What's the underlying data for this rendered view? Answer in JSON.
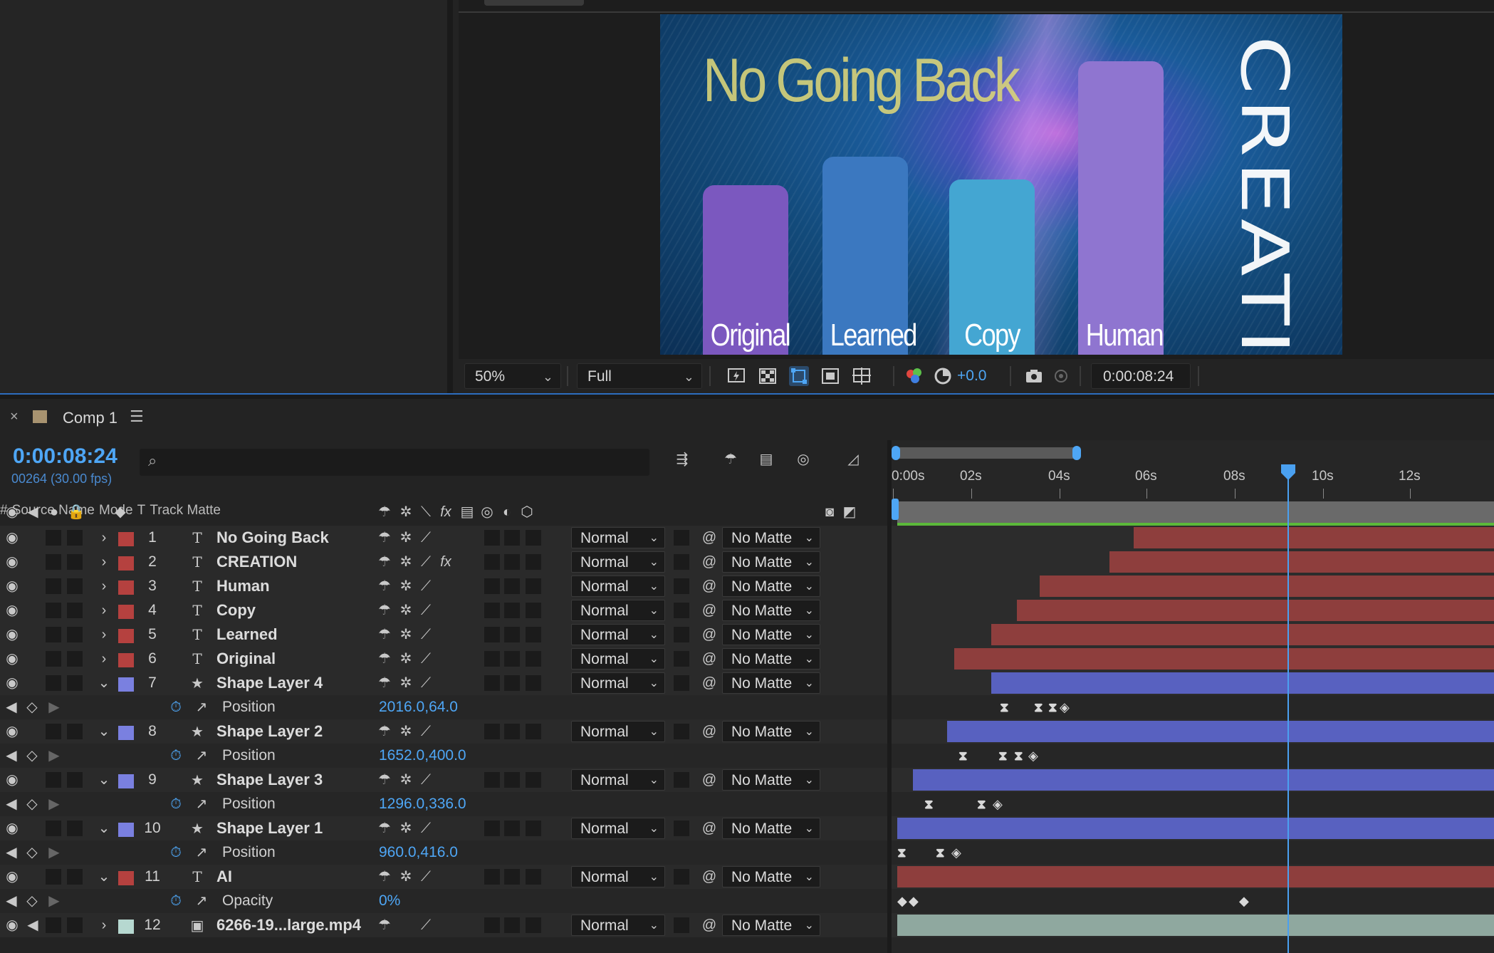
{
  "viewer": {
    "comp_title_text": "No Going Back",
    "comp_vertical_text": "CREATION",
    "bars": [
      {
        "label": "Original",
        "color": "#7b58bf"
      },
      {
        "label": "Learned",
        "color": "#3b78c0"
      },
      {
        "label": "Copy",
        "color": "#44a6d2"
      },
      {
        "label": "Human",
        "color": "#8f75d0"
      }
    ],
    "zoom": "50%",
    "resolution": "Full",
    "exposure": "+0.0",
    "timecode": "0:00:08:24",
    "icons": [
      "fast-previews-icon",
      "transparency-grid-icon",
      "mask-path-icon",
      "region-of-interest-icon",
      "safe-margins-icon",
      "channel-icon",
      "reset-exposure-icon",
      "snapshot-icon",
      "show-snapshot-icon"
    ]
  },
  "timeline": {
    "tab_label": "Comp 1",
    "current_time": "0:00:08:24",
    "frame_info": "00264 (30.00 fps)",
    "search_placeholder": "",
    "columns": {
      "number": "#",
      "source_name": "Source Name",
      "mode": "Mode",
      "t": "T",
      "track_matte": "Track Matte"
    },
    "ruler": [
      "0:00s",
      "02s",
      "04s",
      "06s",
      "08s",
      "10s",
      "12s"
    ],
    "layers": [
      {
        "num": "1",
        "type": "T",
        "name": "No Going Back",
        "color": "#b5413f",
        "mode": "Normal",
        "matte": "No Matte",
        "fx": false
      },
      {
        "num": "2",
        "type": "T",
        "name": "CREATION",
        "color": "#b5413f",
        "mode": "Normal",
        "matte": "No Matte",
        "fx": true
      },
      {
        "num": "3",
        "type": "T",
        "name": "Human",
        "color": "#b5413f",
        "mode": "Normal",
        "matte": "No Matte",
        "fx": false
      },
      {
        "num": "4",
        "type": "T",
        "name": "Copy",
        "color": "#b5413f",
        "mode": "Normal",
        "matte": "No Matte",
        "fx": false
      },
      {
        "num": "5",
        "type": "T",
        "name": "Learned",
        "color": "#b5413f",
        "mode": "Normal",
        "matte": "No Matte",
        "fx": false
      },
      {
        "num": "6",
        "type": "T",
        "name": "Original",
        "color": "#b5413f",
        "mode": "Normal",
        "matte": "No Matte",
        "fx": false
      },
      {
        "num": "7",
        "type": "★",
        "name": "Shape Layer 4",
        "color": "#7a80e0",
        "mode": "Normal",
        "matte": "No Matte",
        "fx": false,
        "prop": {
          "name": "Position",
          "value": "2016.0,64.0"
        }
      },
      {
        "num": "8",
        "type": "★",
        "name": "Shape Layer 2",
        "color": "#7a80e0",
        "mode": "Normal",
        "matte": "No Matte",
        "fx": false,
        "prop": {
          "name": "Position",
          "value": "1652.0,400.0"
        }
      },
      {
        "num": "9",
        "type": "★",
        "name": "Shape Layer 3",
        "color": "#7a80e0",
        "mode": "Normal",
        "matte": "No Matte",
        "fx": false,
        "prop": {
          "name": "Position",
          "value": "1296.0,336.0"
        }
      },
      {
        "num": "10",
        "type": "★",
        "name": "Shape Layer 1",
        "color": "#7a80e0",
        "mode": "Normal",
        "matte": "No Matte",
        "fx": false,
        "prop": {
          "name": "Position",
          "value": "960.0,416.0"
        }
      },
      {
        "num": "11",
        "type": "T",
        "name": "AI",
        "color": "#b5413f",
        "mode": "Normal",
        "matte": "No Matte",
        "fx": false,
        "prop": {
          "name": "Opacity",
          "value": "0%"
        }
      },
      {
        "num": "12",
        "type": "▣",
        "name": "6266-19...large.mp4",
        "color": "#b6d8d0",
        "mode": "Normal",
        "matte": "No Matte",
        "fx": false
      }
    ],
    "colors": {
      "accent": "#4ea6f5",
      "text_bar": "#8e3e3d",
      "shape_bar": "#5861c0",
      "footage_bar": "#8fa89f",
      "work_area": "#5bb83a"
    }
  }
}
